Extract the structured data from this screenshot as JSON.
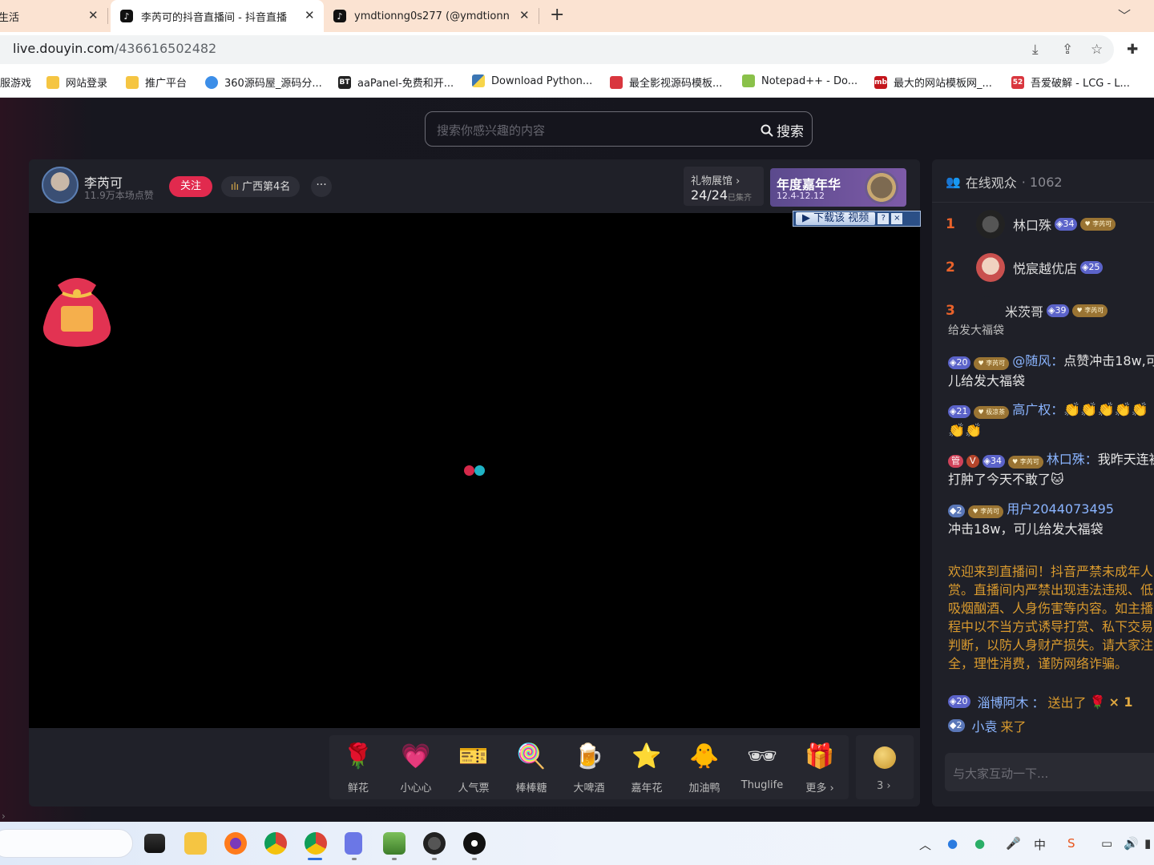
{
  "browser": {
    "tabs": [
      {
        "title": "生活",
        "active": false
      },
      {
        "title": "李芮可的抖音直播间 - 抖音直播",
        "active": true
      },
      {
        "title": "ymdtionng0s277 (@ymdtionn",
        "active": false
      }
    ],
    "url_host": "live.douyin.com",
    "url_path": "/436616502482",
    "bookmarks": [
      {
        "label": "服游戏",
        "icon": "none"
      },
      {
        "label": "网站登录",
        "icon": "folder-icon"
      },
      {
        "label": "推广平台",
        "icon": "folder-icon"
      },
      {
        "label": "360源码屋_源码分...",
        "icon": "cloud-icon"
      },
      {
        "label": "aaPanel-免费和开...",
        "icon": "bt-icon"
      },
      {
        "label": "Download Python...",
        "icon": "python-icon"
      },
      {
        "label": "最全影视源码模板...",
        "icon": "film-icon"
      },
      {
        "label": "Notepad++ - Do...",
        "icon": "notepad-icon"
      },
      {
        "label": "最大的网站模板网_...",
        "icon": "mb-icon"
      },
      {
        "label": "吾爱破解 - LCG - L...",
        "icon": "52-icon"
      }
    ]
  },
  "search": {
    "placeholder": "搜索你感兴趣的内容",
    "button_label": "搜索"
  },
  "anchor": {
    "name": "李芮可",
    "likes": "11.9万本场点赞",
    "follow_label": "关注",
    "rank_label": "广西第4名",
    "more_label": "···"
  },
  "gift_hall": {
    "title": "礼物展馆 ›",
    "count": "24/24",
    "status": "已集齐"
  },
  "carnival": {
    "title": "年度嘉年华",
    "dates": "12.4-12.12"
  },
  "download_overlay": {
    "button_label": "下载该 视频",
    "help_label": "?",
    "close_label": "×"
  },
  "gifts": [
    {
      "label": "鲜花",
      "icon": "🌹"
    },
    {
      "label": "小心心",
      "icon": "💗"
    },
    {
      "label": "人气票",
      "icon": "🎫"
    },
    {
      "label": "棒棒糖",
      "icon": "🍭"
    },
    {
      "label": "大啤酒",
      "icon": "🍺"
    },
    {
      "label": "嘉年花",
      "icon": "⭐"
    },
    {
      "label": "加油鸭",
      "icon": "🐥"
    },
    {
      "label": "Thuglife",
      "icon": "🕶"
    },
    {
      "label": "更多 ›",
      "icon": "🎁"
    }
  ],
  "coin_label": "3 ›",
  "audience": {
    "title": "在线观众",
    "count": "· 1062",
    "top": [
      {
        "rank": "1",
        "name": "林口殊",
        "level": "34",
        "fan": "李芮可"
      },
      {
        "rank": "2",
        "name": "悦宸越优店",
        "level": "25",
        "fan": ""
      },
      {
        "rank": "3",
        "name": "米茨哥",
        "level": "39",
        "fan": "李芮可"
      }
    ]
  },
  "chat": {
    "cut_line": "给发大福袋",
    "messages": [
      {
        "level": "20",
        "fan": "李芮可",
        "user": "@随风",
        "text": "点赞冲击18w,可儿给发大福袋"
      },
      {
        "level": "21",
        "fan": "极凉茶",
        "user": "高广权",
        "text": "👏👏👏👏👏👏👏"
      },
      {
        "badges": [
          "管",
          "V"
        ],
        "level": "34",
        "fan": "李芮可",
        "user": "林口殊",
        "text": "我昨天连被打肿了今天不敢了🐱"
      },
      {
        "level": "2",
        "fan": "李芮可",
        "user": "用户2044073495",
        "text": "冲击18w，可儿给发大福袋"
      }
    ],
    "notice": "欢迎来到直播间！抖音严禁未成年人\n赏。直播间内严禁出现违法违规、低\n吸烟酗酒、人身伤害等内容。如主播\n程中以不当方式诱导打赏、私下交易\n判断，以防人身财产损失。请大家注\n全，理性消费，谨防网络诈骗。",
    "gift_event": {
      "level": "20",
      "user": "淄博阿木",
      "verb": "送出了",
      "gift": "🌹",
      "qty": "× 1"
    },
    "enter_event": {
      "level": "2",
      "user": "小袁",
      "verb": "来了"
    },
    "input_placeholder": "与大家互动一下..."
  },
  "colors": {
    "follow": "#e12a4e",
    "loader_red": "#d5294a",
    "loader_cyan": "#1fb3c5",
    "notice": "#d99a2e",
    "username": "#8ab4ff"
  }
}
